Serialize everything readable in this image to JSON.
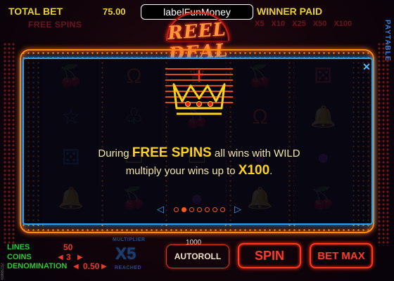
{
  "header": {
    "total_bet_label": "TOTAL BET",
    "total_bet_value": "75.00",
    "player_name": "labelFunMoney",
    "winner_paid_label": "WINNER PAID",
    "free_spins_label": "FREE SPINS",
    "multipliers": [
      "X5",
      "X10",
      "X25",
      "X50",
      "X100"
    ],
    "paytable_label": "PAYTABLE"
  },
  "logo": {
    "text": "REEL DEAL"
  },
  "popup": {
    "line1_prefix": "During ",
    "line1_highlight": "FREE SPINS",
    "line1_suffix": " all wins with WILD",
    "line2_prefix": "multiply your wins up to ",
    "line2_highlight": "X100",
    "line2_suffix": ".",
    "close_symbol": "✕",
    "pager_left": "◁",
    "pager_right": "▷",
    "page_count": 7,
    "active_page": 1
  },
  "controls": {
    "lines_label": "LINES",
    "lines_value": "50",
    "coins_label": "COINS",
    "coins_value": "3",
    "denomination_label": "DENOMINATION",
    "denomination_value": "0.50",
    "multiplier_top_label": "MULTIPLIER",
    "multiplier_value": "X5",
    "multiplier_bottom_label": "REACHED",
    "autoroll_count": "1000",
    "autoroll_label": "AUTOROLL",
    "spin_label": "SPIN",
    "betmax_label": "BET MAX"
  },
  "build_id": "6868232",
  "reels": [
    [
      "cherry-icon",
      "star-icon",
      "dice-icon",
      "bell-icon"
    ],
    [
      "horseshoe-icon",
      "club-icon",
      "bar-icon",
      "cherry-icon"
    ],
    [
      "crown-icon",
      "cherry-icon",
      "bar-icon",
      "plum-icon"
    ],
    [
      "cherry-icon",
      "horseshoe-icon",
      "plum-icon",
      "bell-icon"
    ],
    [
      "dice-icon",
      "bell-icon",
      "plum-icon",
      "cherry-icon"
    ]
  ],
  "colors": {
    "accent_yellow": "#e9d237",
    "neon_red": "#ff3a1a",
    "neon_blue": "#2ea0e8",
    "label_green": "#2fc832"
  }
}
